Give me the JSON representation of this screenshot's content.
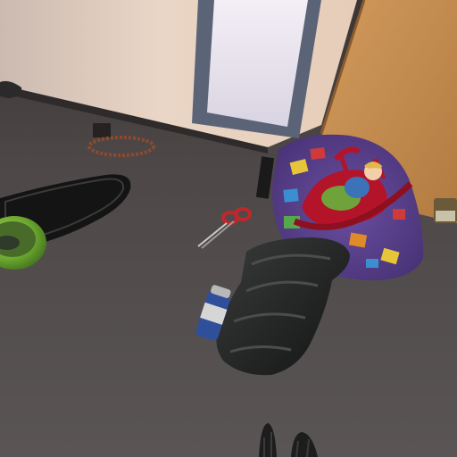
{
  "scene": {
    "view": "first-person",
    "setting": "room floor",
    "objects": [
      "wall",
      "window",
      "wooden-door",
      "carpet-floor",
      "slipper",
      "green-bowl",
      "cord-coil",
      "scissors",
      "play-mat",
      "toy-rocking-cradle",
      "doll",
      "boot",
      "spray-can",
      "player-hands"
    ]
  },
  "colors": {
    "wall": "#e9d7c8",
    "floor": "#4b4646",
    "door": "#c88f52",
    "window_frame": "#5b6476",
    "window_glass": "#ece6f0",
    "mat": "#5b3f8e",
    "cradle": "#b4142a",
    "boot": "#1e1f1f",
    "bowl": "#7dbd3a",
    "scissors": "#c0272d"
  }
}
